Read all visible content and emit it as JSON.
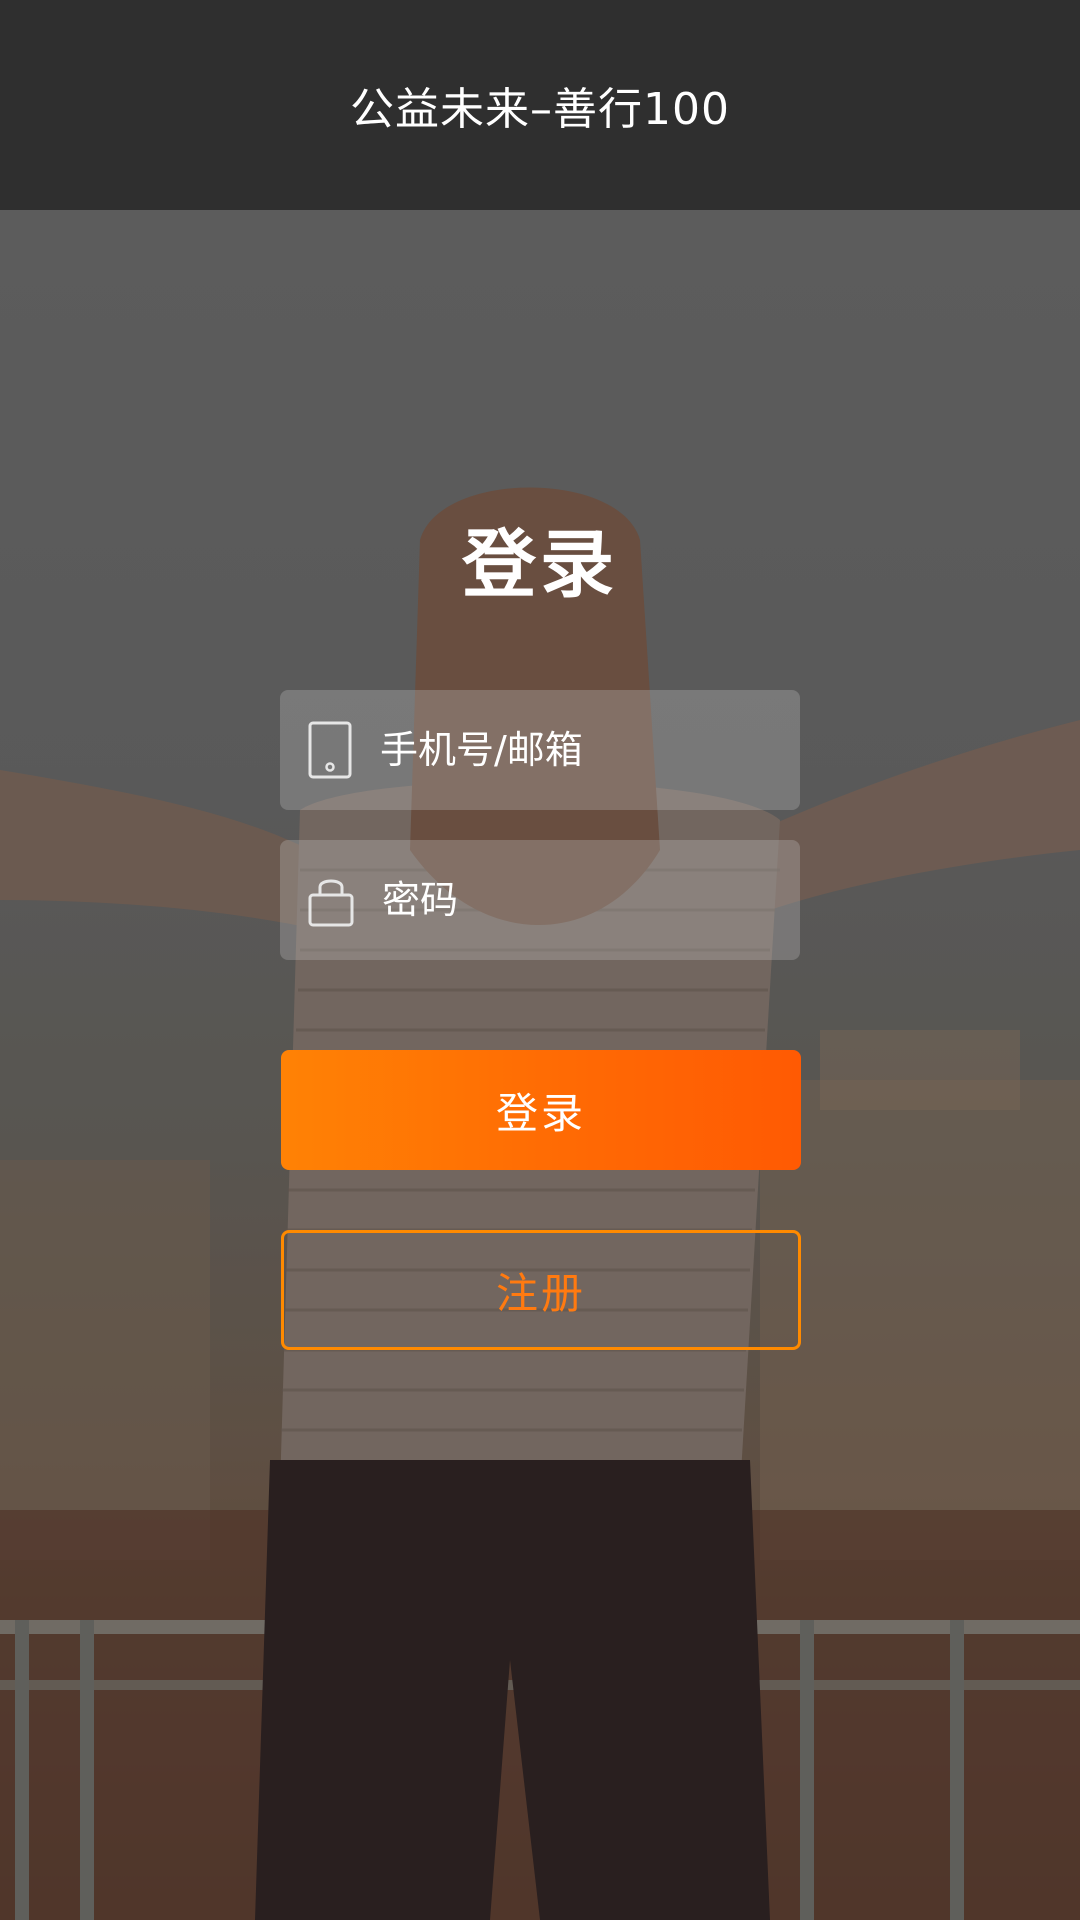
{
  "header": {
    "title": "公益未来–善行100"
  },
  "login": {
    "title": "登录",
    "phone_field": {
      "placeholder": "手机号/邮箱",
      "value": "",
      "icon": "phone-icon"
    },
    "password_field": {
      "placeholder": "密码",
      "value": "",
      "icon": "lock-icon"
    },
    "login_button_label": "登录",
    "register_button_label": "注册"
  },
  "colors": {
    "header_bg": "#2f2f2f",
    "accent": "#ff7a10",
    "accent_gradient_start": "#ff8205",
    "accent_gradient_end": "#ff5a03"
  }
}
